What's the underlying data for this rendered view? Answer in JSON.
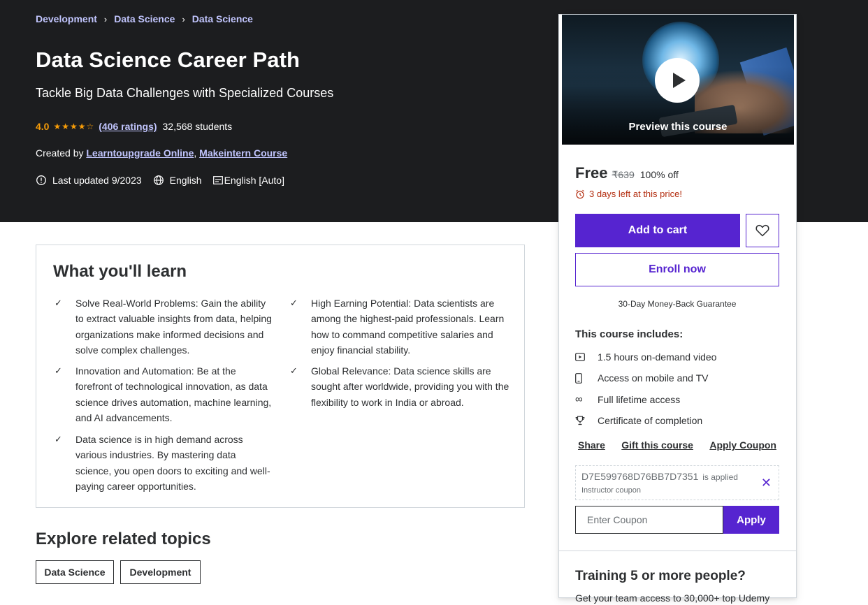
{
  "breadcrumb": [
    "Development",
    "Data Science",
    "Data Science"
  ],
  "course": {
    "title": "Data Science Career Path",
    "subtitle": "Tackle Big Data Challenges with Specialized Courses",
    "rating": "4.0",
    "stars": "★★★★☆",
    "ratings_count": "(406 ratings)",
    "students": "32,568 students",
    "created_by_label": "Created by",
    "authors": [
      "Learntoupgrade Online",
      "Makeintern Course"
    ],
    "last_updated": "Last updated 9/2023",
    "language": "English",
    "captions": "English [Auto]"
  },
  "learn": {
    "title": "What you'll learn",
    "items": [
      "Solve Real-World Problems: Gain the ability to extract valuable insights from data, helping organizations make informed decisions and solve complex challenges.",
      "High Earning Potential: Data scientists are among the highest-paid professionals. Learn how to command competitive salaries and enjoy financial stability.",
      "Innovation and Automation: Be at the forefront of technological innovation, as data science drives automation, machine learning, and AI advancements.",
      "Global Relevance: Data science skills are sought after worldwide, providing you with the flexibility to work in India or abroad.",
      "Data science is in high demand across various industries. By mastering data science, you open doors to exciting and well-paying career opportunities."
    ]
  },
  "explore": {
    "title": "Explore related topics",
    "topics": [
      "Data Science",
      "Development"
    ]
  },
  "sidebar": {
    "preview_label": "Preview this course",
    "price": "Free",
    "original_price": "₹639",
    "discount": "100% off",
    "deadline": "3 days left at this price!",
    "add_to_cart": "Add to cart",
    "enroll_now": "Enroll now",
    "guarantee": "30-Day Money-Back Guarantee",
    "includes_title": "This course includes:",
    "includes": [
      {
        "icon": "video-icon",
        "label": "1.5 hours on-demand video"
      },
      {
        "icon": "mobile-icon",
        "label": "Access on mobile and TV"
      },
      {
        "icon": "infinity-icon",
        "label": "Full lifetime access"
      },
      {
        "icon": "trophy-icon",
        "label": "Certificate of completion"
      }
    ],
    "share": "Share",
    "gift": "Gift this course",
    "apply_coupon": "Apply Coupon",
    "coupon_code": "D7E599768D76BB7D7351",
    "coupon_applied": "is applied",
    "coupon_type": "Instructor coupon",
    "coupon_placeholder": "Enter Coupon",
    "apply": "Apply",
    "training_title": "Training 5 or more people?",
    "training_desc": "Get your team access to 30,000+ top Udemy"
  },
  "colors": {
    "hero_bg": "#1c1d1f",
    "accent": "#5624d0",
    "link_light": "#c0c4fc",
    "star": "#f69c08",
    "urgent": "#b32d0f"
  }
}
